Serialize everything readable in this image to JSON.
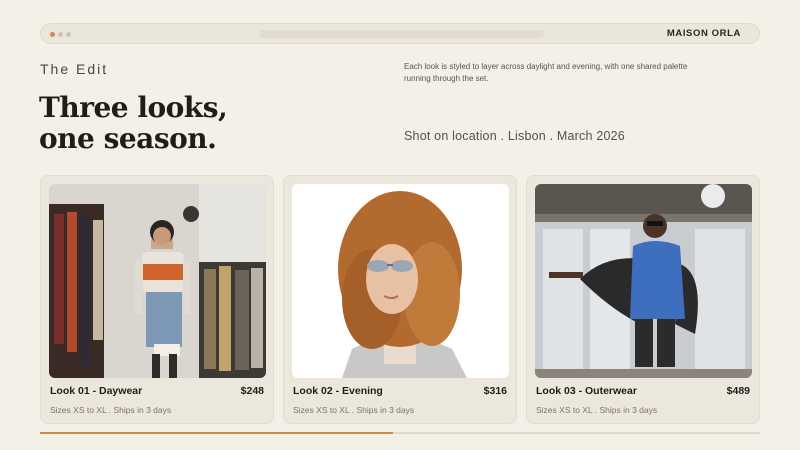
{
  "header": {
    "brand": "MAISON ORLA"
  },
  "hero": {
    "eyebrow": "The Edit",
    "headline_line1": "Three looks,",
    "headline_line2": "one season.",
    "intro": "Each look is styled to layer across daylight and evening, with one shared palette running through the set.",
    "shot_line": "Shot on location . Lisbon . March 2026"
  },
  "looks": [
    {
      "title": "Look 01 - Daywear",
      "price": "$248",
      "meta": "Sizes XS to XL . Ships in 3 days"
    },
    {
      "title": "Look 02 - Evening",
      "price": "$316",
      "meta": "Sizes XS to XL . Ships in 3 days"
    },
    {
      "title": "Look 03 - Outerwear",
      "price": "$489",
      "meta": "Sizes XS to XL . Ships in 3 days"
    }
  ],
  "progress": {
    "fraction": 0.49
  },
  "colors": {
    "accent": "#d8874a",
    "background": "#f3f0e8",
    "card": "#ece7dc"
  }
}
